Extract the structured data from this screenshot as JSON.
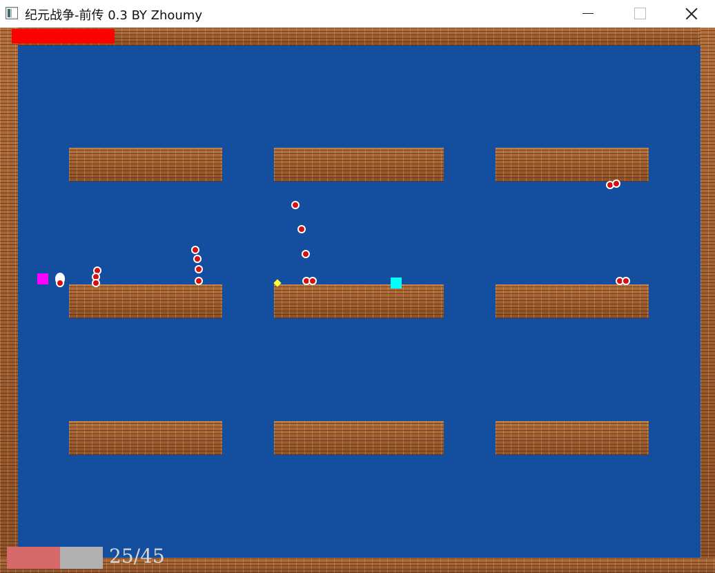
{
  "window": {
    "title": "纪元战争-前传 0.3 BY Zhoumy"
  },
  "hud": {
    "player_health_color": "#ff0000",
    "ammo_current": 25,
    "ammo_max": 45,
    "ammo_text": "25/45",
    "ammo_fill_color": "#d66a6a",
    "ammo_empty_color": "#b0b0b0"
  },
  "colors": {
    "background": "#134f9e",
    "brick": "#9c5a2e",
    "player": "#ff00ff",
    "enemy": "#d41010",
    "pickup": "#00ffff",
    "gem": "#ffff33"
  },
  "icons": {
    "minimize": "minimize-icon",
    "maximize": "maximize-icon",
    "close": "close-icon"
  }
}
